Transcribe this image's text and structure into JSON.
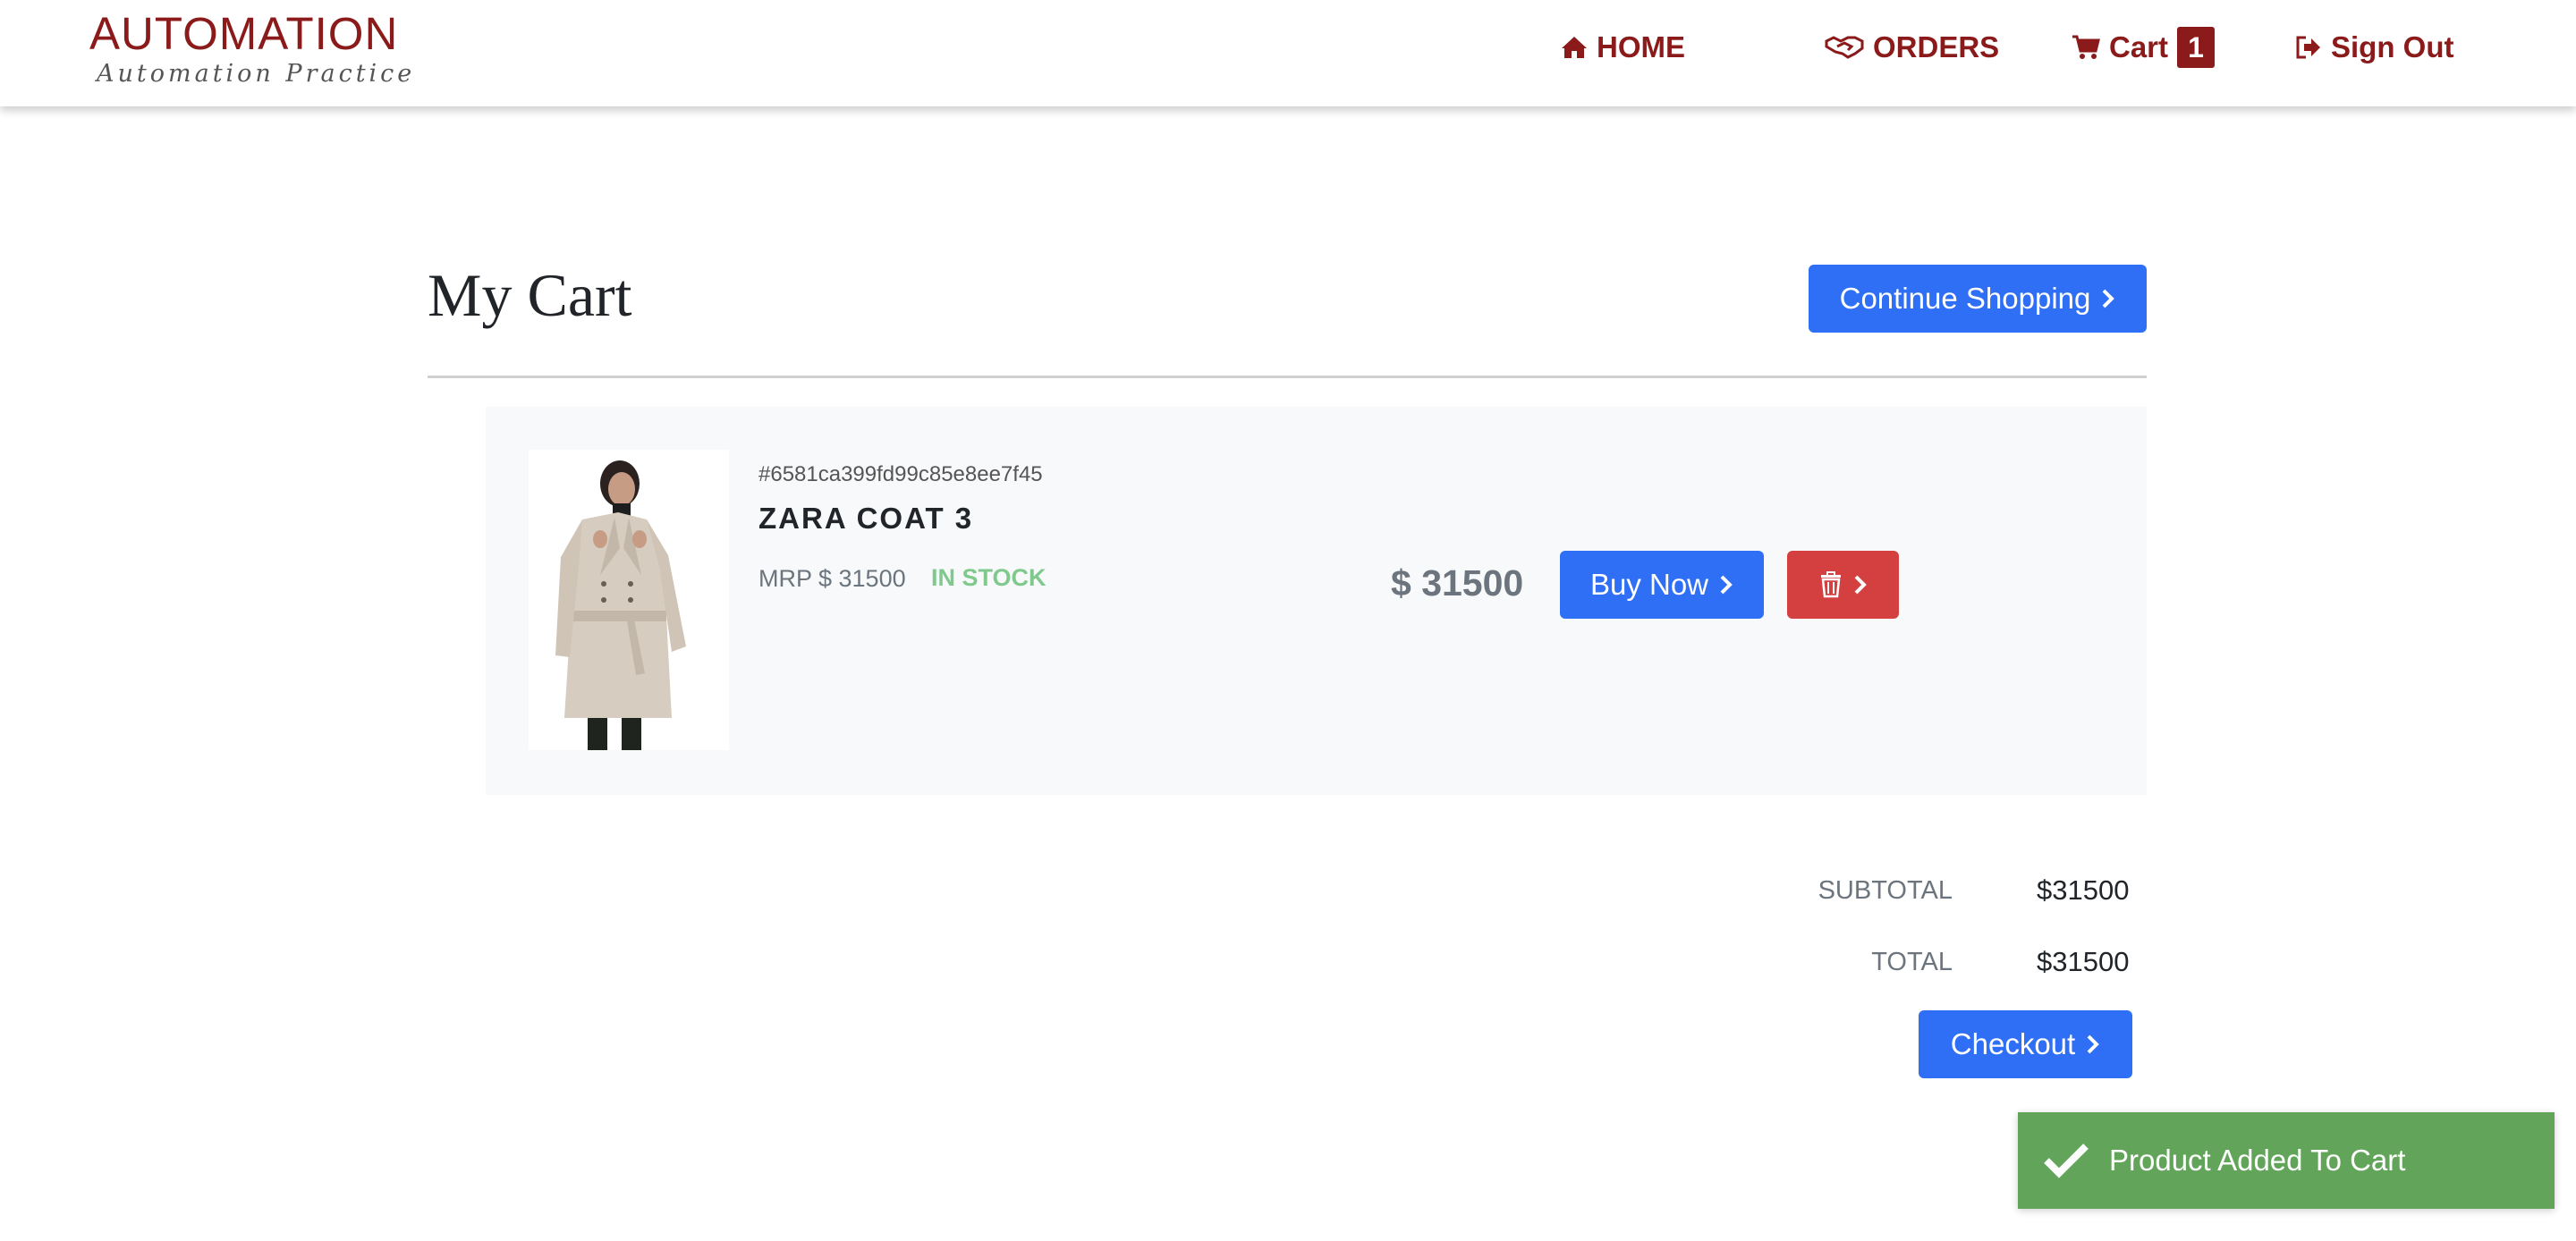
{
  "brand": {
    "title": "AUTOMATION",
    "subtitle": "Automation Practice"
  },
  "nav": {
    "home": "HOME",
    "orders": "ORDERS",
    "cart": "Cart",
    "cart_count": "1",
    "sign_out": "Sign Out"
  },
  "page": {
    "title": "My Cart",
    "continue_label": "Continue Shopping"
  },
  "cart_item": {
    "id": "#6581ca399fd99c85e8ee7f45",
    "name": "ZARA COAT 3",
    "mrp": "MRP $ 31500",
    "stock": "IN STOCK",
    "price": "$ 31500",
    "buy_label": "Buy Now"
  },
  "summary": {
    "subtotal_label": "SUBTOTAL",
    "subtotal_value": "$31500",
    "total_label": "TOTAL",
    "total_value": "$31500",
    "checkout_label": "Checkout"
  },
  "toast": {
    "message": "Product Added To Cart"
  },
  "colors": {
    "brand": "#8b1a1a",
    "primary": "#2f6ff5",
    "danger": "#d3403f",
    "success": "#62a55a",
    "stock": "#7fc98d"
  }
}
